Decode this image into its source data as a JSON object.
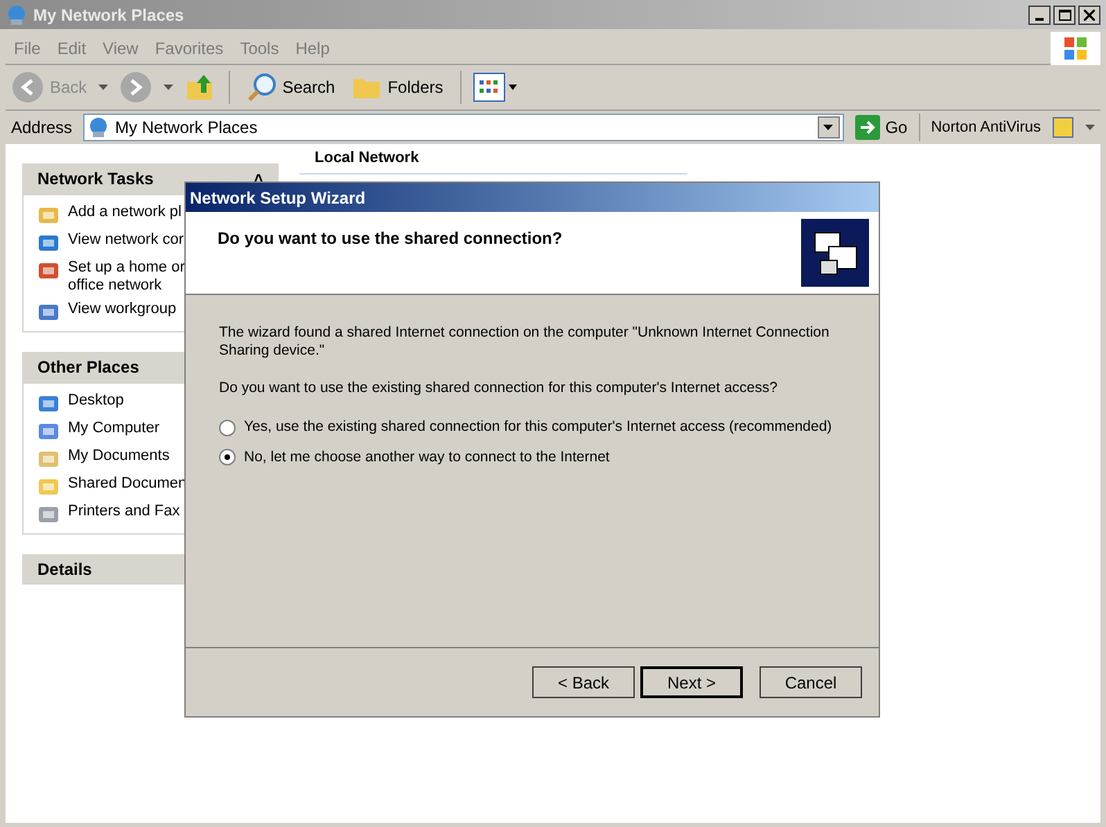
{
  "window": {
    "title": "My Network Places"
  },
  "menu": [
    "File",
    "Edit",
    "View",
    "Favorites",
    "Tools",
    "Help"
  ],
  "toolbar": {
    "back": "Back",
    "search": "Search",
    "folders": "Folders"
  },
  "address": {
    "label": "Address",
    "value": "My Network Places",
    "go": "Go",
    "norton": "Norton AntiVirus"
  },
  "panes": [
    {
      "title": "Network Tasks",
      "collapse": "˄",
      "items": [
        {
          "label": "Add a network pl"
        },
        {
          "label": "View network cor"
        },
        {
          "label": "Set up a home or\noffice network"
        },
        {
          "label": "View workgroup"
        }
      ]
    },
    {
      "title": "Other Places",
      "items": [
        {
          "label": "Desktop"
        },
        {
          "label": "My Computer"
        },
        {
          "label": "My Documents"
        },
        {
          "label": "Shared Documen"
        },
        {
          "label": "Printers and Fax"
        }
      ]
    },
    {
      "title": "Details"
    }
  ],
  "content": {
    "group_header": "Local Network"
  },
  "dialog": {
    "title": "Network Setup Wizard",
    "heading": "Do you want to use the shared connection?",
    "text": "The wizard found a shared Internet connection on the computer \"Unknown Internet Connection Sharing device.\"",
    "question": "Do you want to use the existing shared connection for this computer's Internet access?",
    "options": [
      {
        "label": "Yes, use the existing shared connection for this computer's Internet access (recommended)",
        "selected": false
      },
      {
        "label": "No, let me choose another way to connect to the Internet",
        "selected": true
      }
    ],
    "buttons": [
      {
        "label": "< Back",
        "default": false
      },
      {
        "label": "Next >",
        "default": true
      },
      {
        "label": "Cancel",
        "default": false
      }
    ]
  }
}
